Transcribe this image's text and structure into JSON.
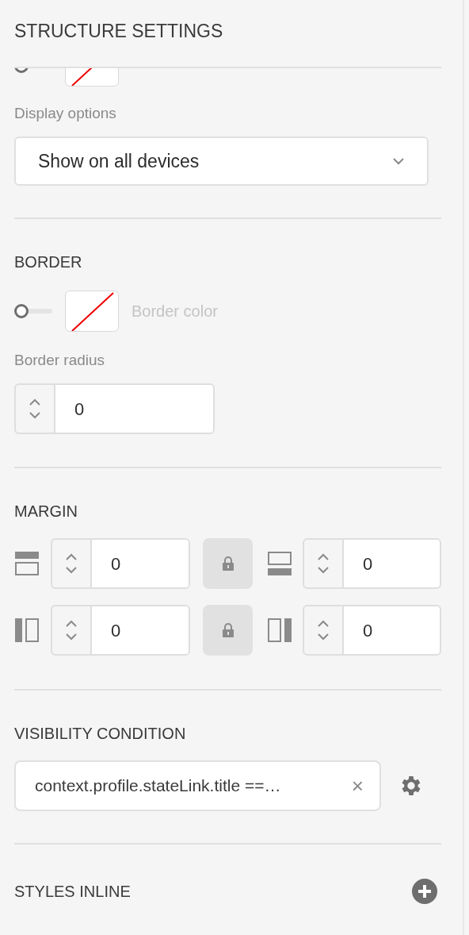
{
  "panel_title": "STRUCTURE SETTINGS",
  "background": {
    "on": false
  },
  "display_options": {
    "label": "Display options",
    "value": "Show on all devices"
  },
  "border": {
    "heading": "BORDER",
    "on": false,
    "color_label": "Border color",
    "radius_label": "Border radius",
    "radius_value": "0"
  },
  "margin": {
    "heading": "MARGIN",
    "rows": [
      {
        "left": {
          "kind": "top",
          "value": "0"
        },
        "locked": true,
        "right": {
          "kind": "bottom",
          "value": "0"
        }
      },
      {
        "left": {
          "kind": "left",
          "value": "0"
        },
        "locked": true,
        "right": {
          "kind": "right",
          "value": "0"
        }
      }
    ]
  },
  "visibility_condition": {
    "heading": "VISIBILITY CONDITION",
    "value": "context.profile.stateLink.title ==…",
    "clear": "×"
  },
  "styles_inline": {
    "heading": "STYLES INLINE"
  }
}
